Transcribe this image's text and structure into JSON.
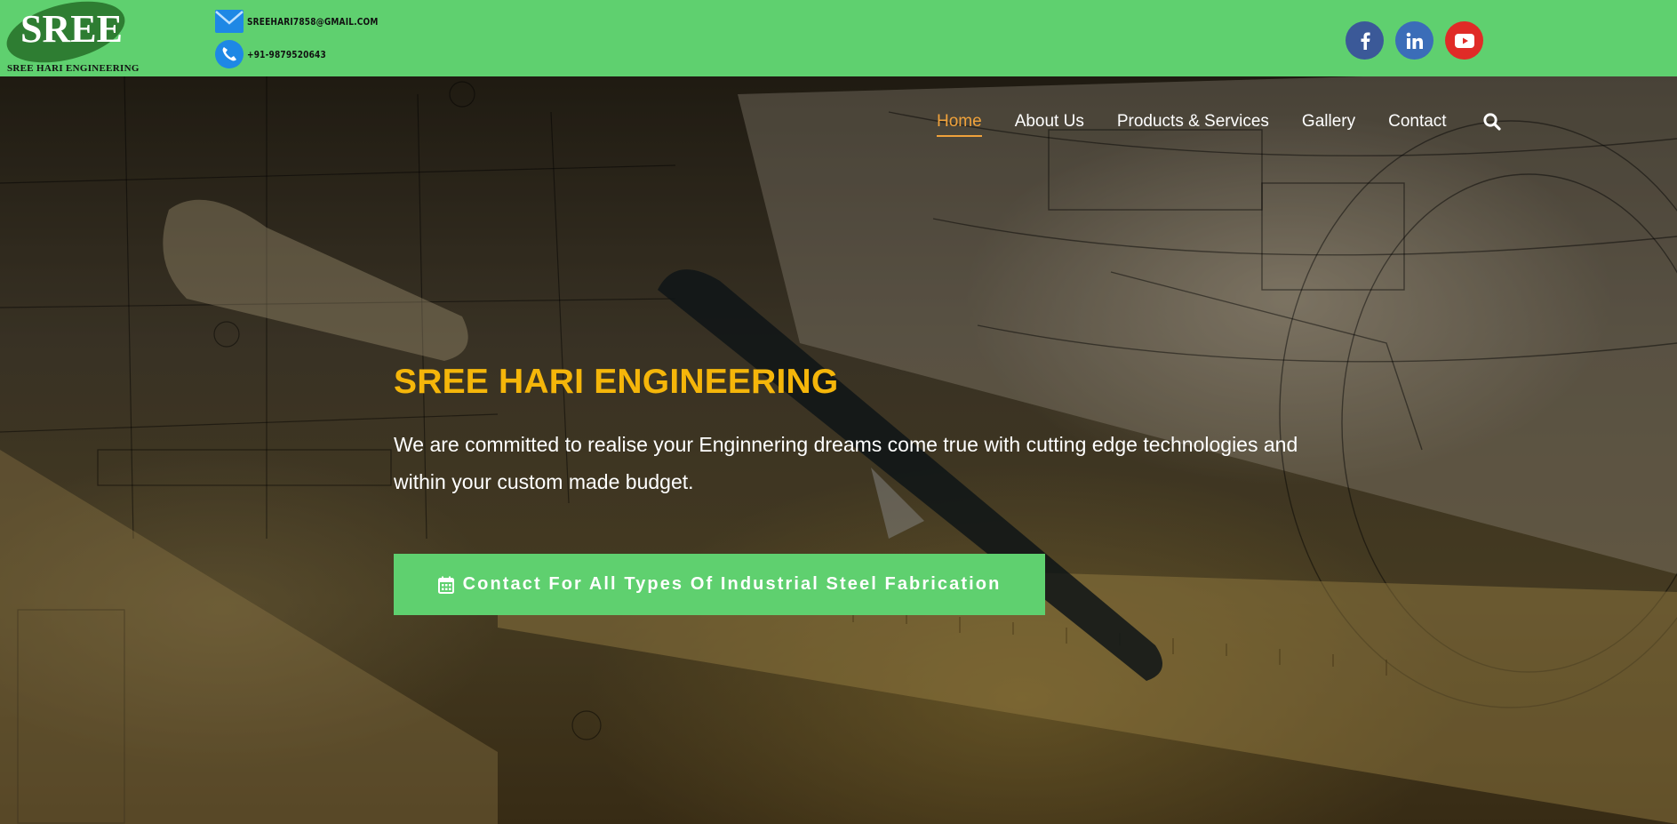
{
  "header": {
    "logo_text": "SREE",
    "logo_subtitle": "SREE HARI ENGINEERING",
    "email": "SREEHARI7858@GMAIL.COM",
    "phone": "+91-9879520643",
    "social": [
      {
        "name": "facebook",
        "icon": "facebook-icon"
      },
      {
        "name": "linkedin",
        "icon": "linkedin-icon"
      },
      {
        "name": "youtube",
        "icon": "youtube-icon"
      }
    ]
  },
  "nav": {
    "items": [
      {
        "label": "Home",
        "active": true
      },
      {
        "label": "About Us",
        "active": false
      },
      {
        "label": "Products & Services",
        "active": false
      },
      {
        "label": "Gallery",
        "active": false
      },
      {
        "label": "Contact",
        "active": false
      }
    ],
    "search_icon": "search-icon"
  },
  "hero": {
    "title": "SREE HARI ENGINEERING",
    "text": "We are committed to realise your Enginnering dreams come true with cutting edge technologies and within your custom made budget.",
    "cta_label": "Contact For All Types Of Industrial Steel Fabrication",
    "cta_icon": "calendar-icon"
  },
  "colors": {
    "topbar": "#5fd06f",
    "accent_title": "#f5b60a",
    "nav_active": "#f0a23b",
    "facebook": "#3b5998",
    "linkedin": "#3b6db8",
    "youtube": "#e02b27"
  }
}
